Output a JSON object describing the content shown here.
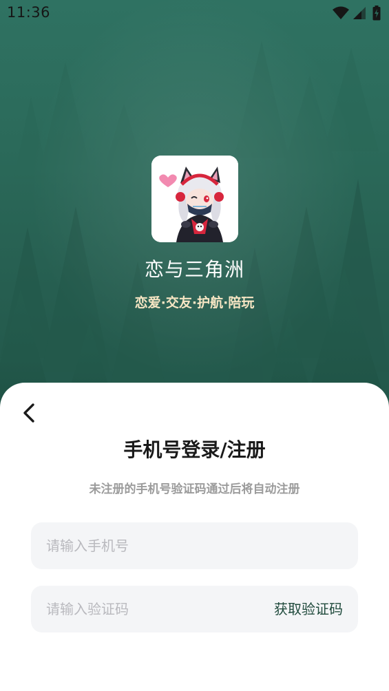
{
  "status_bar": {
    "time": "11:36",
    "icons": [
      "wifi-icon",
      "cellular-signal-icon",
      "battery-charging-icon"
    ]
  },
  "app": {
    "name": "恋与三角洲",
    "slogan": "恋爱·交友·护航·陪玩",
    "logo": "anime-girl-mascot"
  },
  "login": {
    "title": "手机号登录/注册",
    "subtitle": "未注册的手机号验证码通过后将自动注册",
    "phone_placeholder": "请输入手机号",
    "phone_value": "",
    "code_placeholder": "请输入验证码",
    "code_value": "",
    "get_code_label": "获取验证码"
  },
  "colors": {
    "hero_green": "#2b6a5a",
    "slogan_cream": "#f7e6c4",
    "accent_dark_green": "#1f4a3c",
    "field_bg": "#f4f5f7"
  }
}
